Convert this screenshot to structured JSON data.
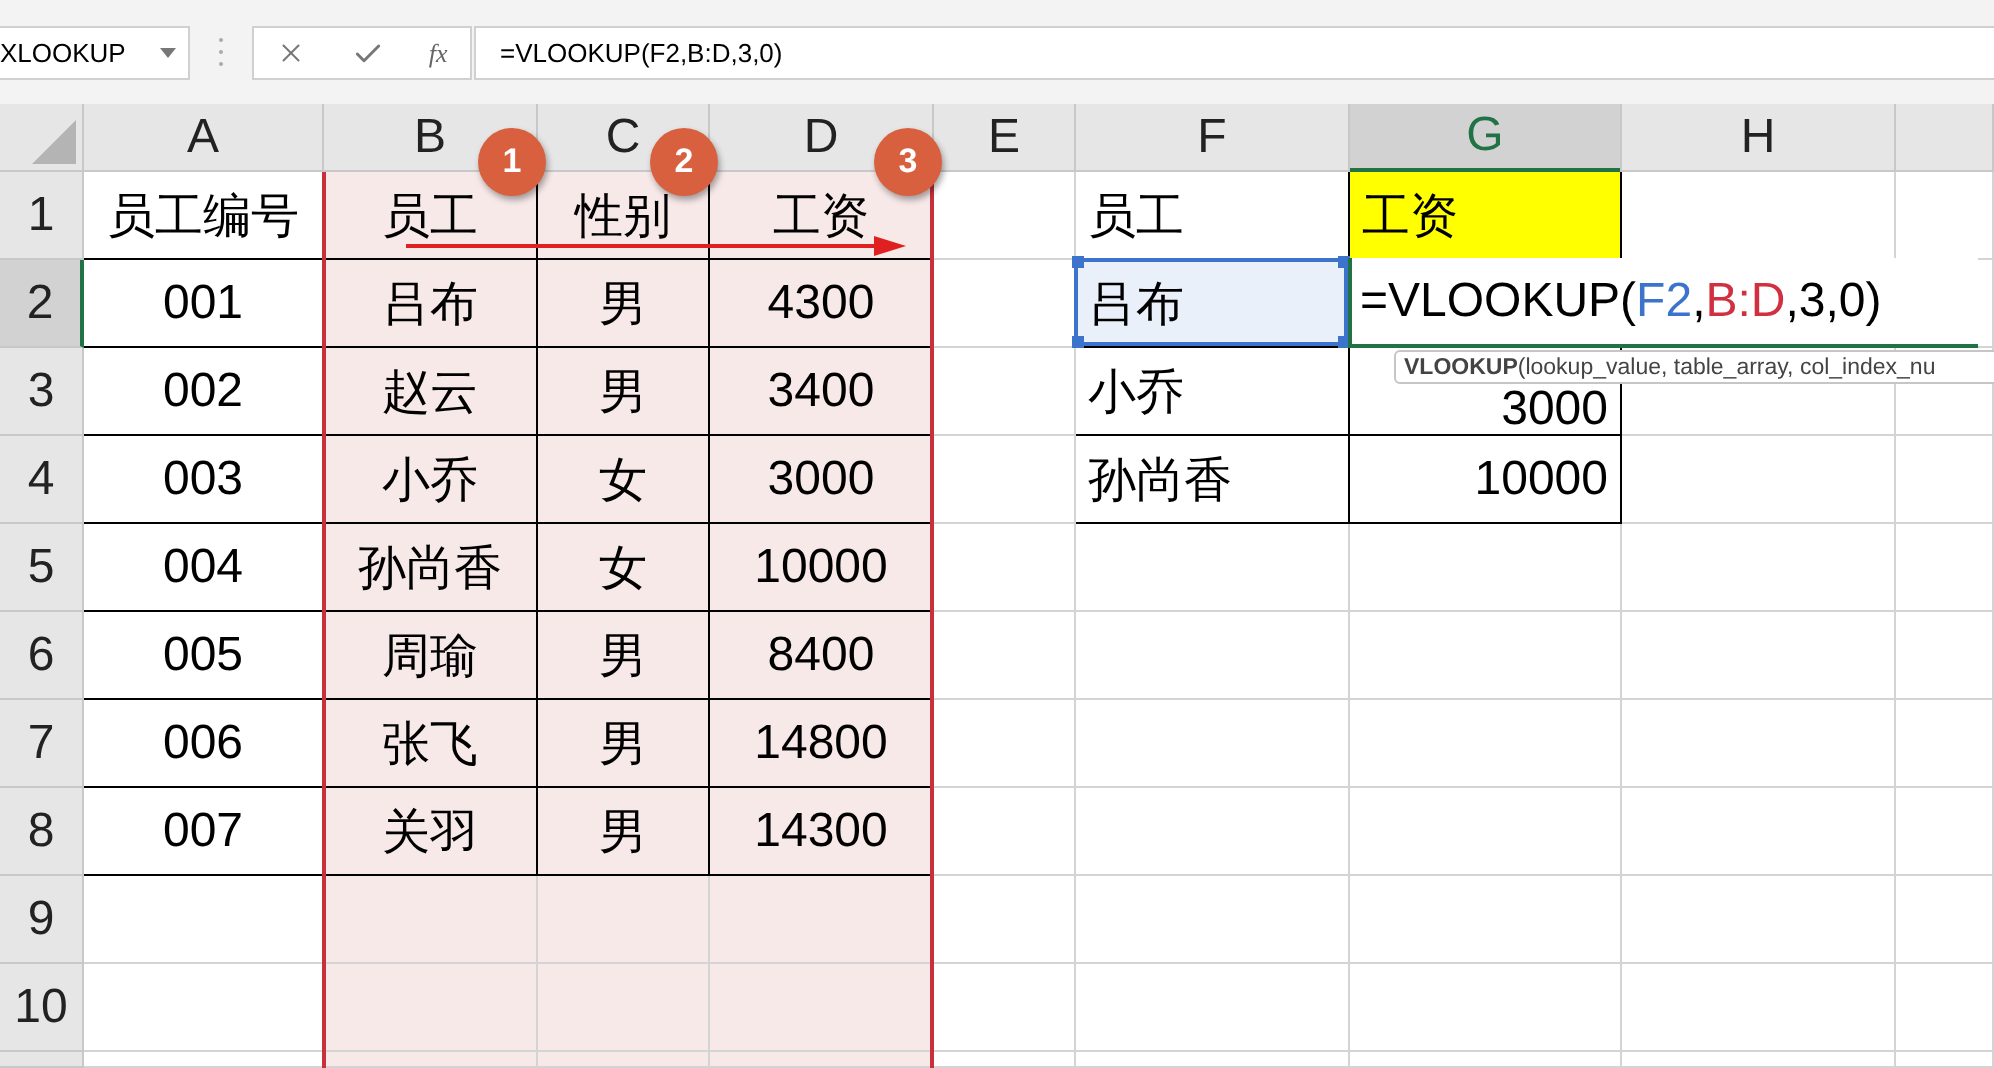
{
  "name_box": {
    "value": "XLOOKUP"
  },
  "formula_bar": {
    "function_label": "fx",
    "value": "=VLOOKUP(F2,B:D,3,0)"
  },
  "columns": [
    {
      "label": "A",
      "selected": false,
      "referenced": false
    },
    {
      "label": "B",
      "selected": false,
      "referenced": true
    },
    {
      "label": "C",
      "selected": false,
      "referenced": true
    },
    {
      "label": "D",
      "selected": false,
      "referenced": true
    },
    {
      "label": "E",
      "selected": false,
      "referenced": false
    },
    {
      "label": "F",
      "selected": false,
      "referenced": false
    },
    {
      "label": "G",
      "selected": true,
      "referenced": false
    },
    {
      "label": "H",
      "selected": false,
      "referenced": false
    }
  ],
  "rows": [
    {
      "label": "1",
      "selected": false,
      "cells": {
        "A": {
          "kind": "text",
          "text": "员工编号"
        },
        "B": {
          "kind": "text",
          "text": "员工"
        },
        "C": {
          "kind": "text",
          "text": "性别"
        },
        "D": {
          "kind": "text",
          "text": "工资"
        },
        "F": {
          "kind": "text",
          "text": "员工"
        },
        "G": {
          "kind": "text",
          "text": "工资",
          "color": "#ffff00"
        }
      }
    },
    {
      "label": "2",
      "selected": true,
      "cells": {
        "A": {
          "kind": "text",
          "text": "001"
        },
        "B": {
          "kind": "text",
          "text": "吕布"
        },
        "C": {
          "kind": "text",
          "text": "男"
        },
        "D": {
          "kind": "text",
          "text": "4300"
        },
        "F": {
          "kind": "text",
          "text": "吕布",
          "referenced": true
        },
        "G": {
          "kind": "formula",
          "parts": [
            {
              "text": "=VLOOKUP(",
              "color": "#000000"
            },
            {
              "text": "F2",
              "color": "#3c74cc"
            },
            {
              "text": ",",
              "color": "#000000"
            },
            {
              "text": "B:D",
              "color": "#d03040"
            },
            {
              "text": ",3,0)",
              "color": "#000000"
            }
          ]
        }
      }
    },
    {
      "label": "3",
      "selected": false,
      "cells": {
        "A": {
          "kind": "text",
          "text": "002"
        },
        "B": {
          "kind": "text",
          "text": "赵云"
        },
        "C": {
          "kind": "text",
          "text": "男"
        },
        "D": {
          "kind": "text",
          "text": "3400"
        },
        "F": {
          "kind": "text",
          "text": "小乔"
        },
        "G": {
          "kind": "number",
          "text": "3000"
        }
      }
    },
    {
      "label": "4",
      "selected": false,
      "cells": {
        "A": {
          "kind": "text",
          "text": "003"
        },
        "B": {
          "kind": "text",
          "text": "小乔"
        },
        "C": {
          "kind": "text",
          "text": "女"
        },
        "D": {
          "kind": "text",
          "text": "3000"
        },
        "F": {
          "kind": "text",
          "text": "孙尚香"
        },
        "G": {
          "kind": "number",
          "text": "10000"
        }
      }
    },
    {
      "label": "5",
      "selected": false,
      "cells": {
        "A": {
          "kind": "text",
          "text": "004"
        },
        "B": {
          "kind": "text",
          "text": "孙尚香"
        },
        "C": {
          "kind": "text",
          "text": "女"
        },
        "D": {
          "kind": "text",
          "text": "10000"
        }
      }
    },
    {
      "label": "6",
      "selected": false,
      "cells": {
        "A": {
          "kind": "text",
          "text": "005"
        },
        "B": {
          "kind": "text",
          "text": "周瑜"
        },
        "C": {
          "kind": "text",
          "text": "男"
        },
        "D": {
          "kind": "text",
          "text": "8400"
        }
      }
    },
    {
      "label": "7",
      "selected": false,
      "cells": {
        "A": {
          "kind": "text",
          "text": "006"
        },
        "B": {
          "kind": "text",
          "text": "张飞"
        },
        "C": {
          "kind": "text",
          "text": "男"
        },
        "D": {
          "kind": "text",
          "text": "14800"
        }
      }
    },
    {
      "label": "8",
      "selected": false,
      "cells": {
        "A": {
          "kind": "text",
          "text": "007"
        },
        "B": {
          "kind": "text",
          "text": "关羽"
        },
        "C": {
          "kind": "text",
          "text": "男"
        },
        "D": {
          "kind": "text",
          "text": "14300"
        }
      }
    },
    {
      "label": "9",
      "selected": false,
      "cells": {}
    },
    {
      "label": "10",
      "selected": false,
      "cells": {}
    }
  ],
  "badges": [
    "1",
    "2",
    "3"
  ],
  "tooltip": {
    "function": "VLOOKUP",
    "arguments": "(lookup_value, table_array, col_index_nu"
  }
}
